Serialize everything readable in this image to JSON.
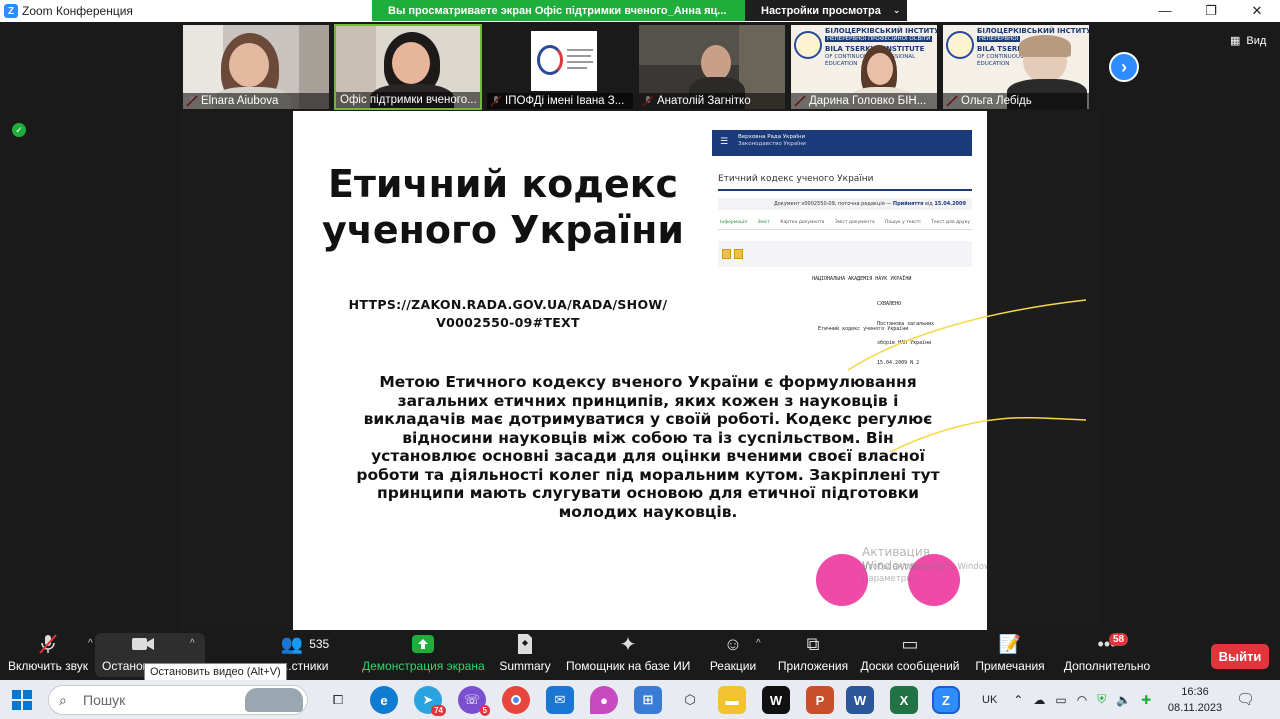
{
  "window": {
    "title": "Zoom Конференция"
  },
  "share_banner": {
    "text": "Вы просматриваете экран Офіс підтримки вченого_Анна яц..."
  },
  "view_options": {
    "label": "Настройки просмотра"
  },
  "view_button": {
    "label": "Вид"
  },
  "participants_strip": [
    {
      "name": "Elnara Aiubova",
      "muted": true
    },
    {
      "name": "Офіс підтримки вченого...",
      "muted": false,
      "active": true
    },
    {
      "name": "ІПОФДі імені Івана З...",
      "muted": true
    },
    {
      "name": "Анатолій Загнітко",
      "muted": true
    },
    {
      "name": "Дарина Головко БІН...",
      "muted": true,
      "logo_text": [
        "БІЛОЦЕРКІВСЬКИЙ ІНСТИТУТ",
        "НЕПЕРЕРВНОЇ ПРОФЕСІЙНОЇ ОСВІТИ",
        "BILA TSERKVA INSTITUTE",
        "OF CONTINUOUS PROFESSIONAL",
        "EDUCATION"
      ]
    },
    {
      "name": "Ольга Лебідь",
      "muted": true,
      "logo_text": [
        "БІЛОЦЕРКІВСЬКИЙ ІНСТИТУТ",
        "НЕПЕРЕРВНОЇ",
        "BILA TSERKVA",
        "OF CONTINUOUS",
        "EDUCATION"
      ]
    }
  ],
  "slide": {
    "title_line1": "Етичний кодекс",
    "title_line2": "ученого України",
    "url_line1": "HTTPS://ZAKON.RADA.GOV.UA/RADA/SHOW/",
    "url_line2": "V0002550-09#TEXT",
    "body_lines": [
      "Метою Етичного кодексу вченого України є формулювання",
      "загальних етичних принципів, яких кожен з науковців і",
      "викладачів має дотримуватися у своїй роботі. Кодекс регулює",
      "відносини науковців між собою та із суспільством. Він",
      "установлює основні засади для оцінки вченими своєї власної",
      "роботи та діяльності колег під моральним кутом. Закріплені тут",
      "принципи мають слугувати основою для етичної підготовки",
      "молодих науковців."
    ],
    "doc": {
      "header_line1": "Верховна Рада України",
      "header_line2": "Законодавство України",
      "title": "Етичний кодекс ученого України",
      "meta_prefix": "Документ v0002550-09, поточна редакція — ",
      "meta_bold": "Прийняття",
      "meta_suffix": " від ",
      "meta_date": "15.04.2009",
      "tabs": [
        "Інформація",
        "Зміст",
        "Картка документа",
        "Зміст документа",
        "Пошук у тексті",
        "Текст для друку"
      ],
      "org": "НАЦІОНАЛЬНА АКАДЕМІЯ НАУК УКРАЇНИ",
      "approved_lines": [
        "СХВАЛЕНО",
        "Постанова загальних",
        "зборів НАН України",
        "15.04.2009 N 2"
      ],
      "doc_name": "Етичний кодекс ученого України"
    },
    "watermark_title": "Активация Windows",
    "watermark_sub1": "Чтобы активировать Windows, перейдите в раздел",
    "watermark_sub2": "Параметры."
  },
  "toolbar": {
    "mute": "Включить звук",
    "video": "Останов...",
    "participants": "...стники",
    "participants_count": "535",
    "share": "Демонстрация экрана",
    "summary": "Summary",
    "ai": "Помощник на базе ИИ",
    "reactions": "Реакции",
    "apps": "Приложения",
    "whiteboards": "Доски сообщений",
    "notes": "Примечания",
    "more": "Дополнительно",
    "more_badge": "58",
    "leave": "Выйти",
    "tooltip": "Остановить видео (Alt+V)"
  },
  "taskbar": {
    "search_placeholder": "Пошук",
    "telegram_badge": "74",
    "viber_badge": "5",
    "lang": "UK",
    "time": "16:36",
    "date": "08.11.2023"
  },
  "colors": {
    "zoom_blue": "#2d8cff",
    "share_green": "#1fae3c",
    "leave_red": "#e0363b",
    "slide_accent": "#f04aa8",
    "line_yellow": "#f5d84a"
  }
}
